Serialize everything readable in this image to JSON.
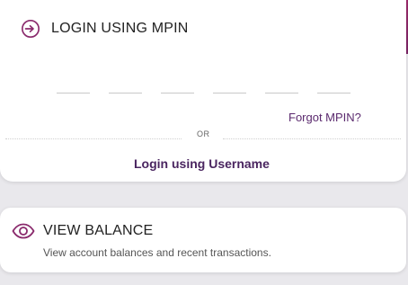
{
  "login": {
    "title": "LOGIN USING MPIN",
    "icon": "login-arrow-icon",
    "pin_placeholders": [
      "",
      "",
      "",
      "",
      "",
      ""
    ],
    "forgot_label": "Forgot MPIN?",
    "or_label": "OR",
    "username_label": "Login using Username"
  },
  "balance": {
    "title": "VIEW BALANCE",
    "icon": "eye-icon",
    "subtitle": "View account balances and recent transactions."
  },
  "colors": {
    "brand": "#7a2466",
    "brand_text": "#4a2560",
    "link": "#5b2a6e"
  }
}
